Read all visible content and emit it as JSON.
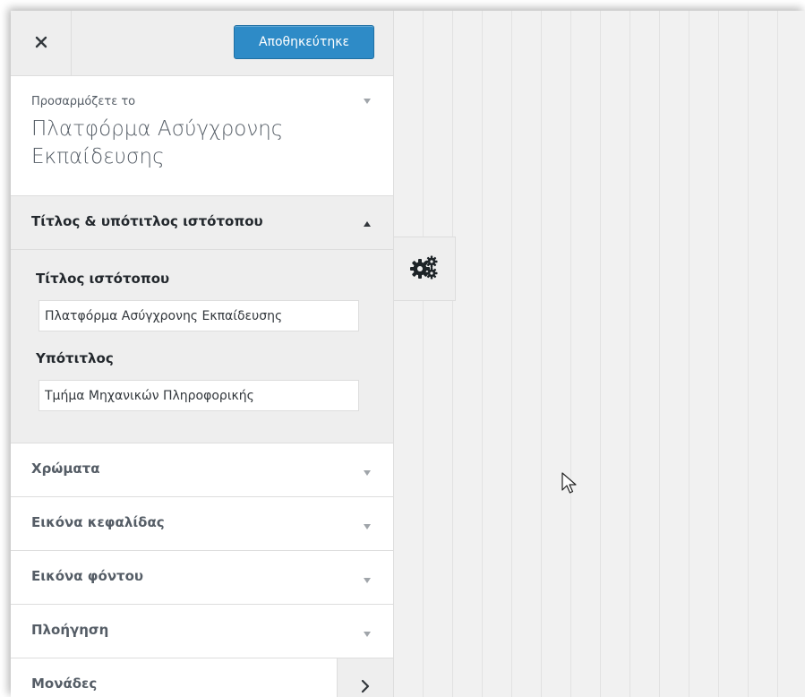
{
  "toolbar": {
    "close_icon": "close-icon",
    "save_label": "Αποθηκεύτηκε",
    "save_color": "#2e8bc7"
  },
  "info": {
    "caption": "Προσαρμόζετε το",
    "site_title": "Πλατφόρμα Ασύγχρονης Εκπαίδευσης"
  },
  "section_open": {
    "label": "Τίτλος & υπότιτλος ιστότοπου",
    "fields": [
      {
        "label": "Τίτλος ιστότοπου",
        "value": "Πλατφόρμα Ασύγχρονης Εκπαίδευσης"
      },
      {
        "label": "Υπότιτλος",
        "value": "Τμήμα Μηχανικών Πληροφορικής"
      }
    ]
  },
  "sections": [
    {
      "label": "Χρώματα"
    },
    {
      "label": "Εικόνα κεφαλίδας"
    },
    {
      "label": "Εικόνα φόντου"
    },
    {
      "label": "Πλοήγηση"
    },
    {
      "label": "Μονάδες"
    }
  ],
  "preview": {
    "gear_icon": "gears-icon"
  }
}
